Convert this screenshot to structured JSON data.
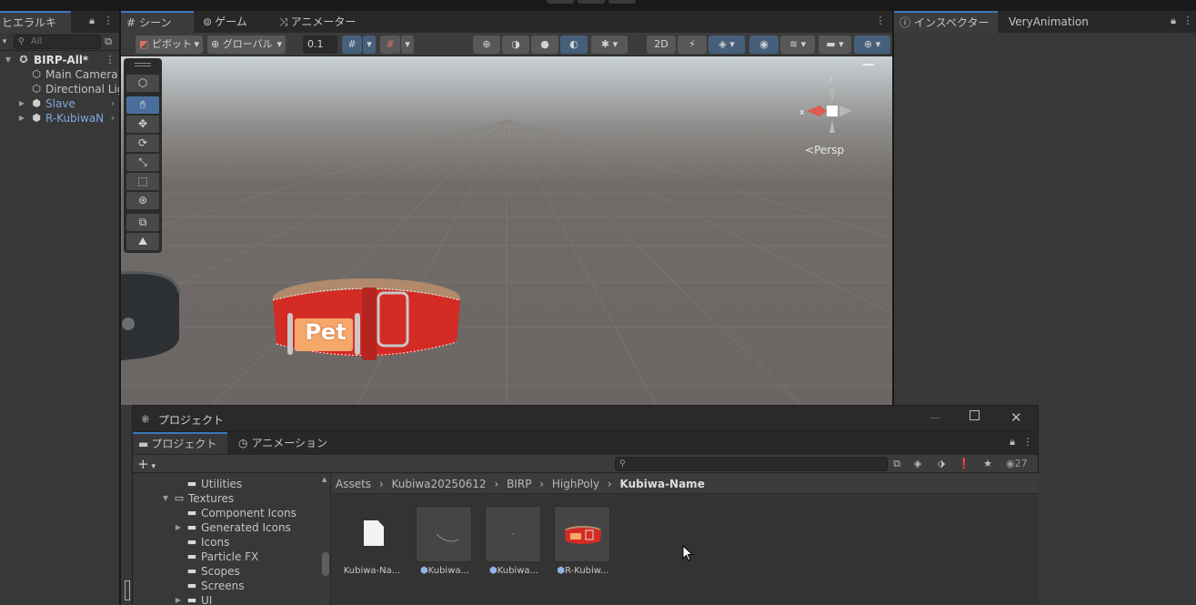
{
  "hierarchy": {
    "tab": "ヒエラルキー",
    "search_placeholder": "All",
    "scene": "BIRP-All*",
    "items": [
      {
        "label": "Main Camera"
      },
      {
        "label": "Directional Light"
      },
      {
        "label": "Slave"
      },
      {
        "label": "R-KubiwaN"
      }
    ]
  },
  "scene_tabs": {
    "scene": "シーン",
    "game": "ゲーム",
    "animator": "アニメーター"
  },
  "scene_toolbar": {
    "pivot": "ピボット",
    "global": "グローバル",
    "snap_value": "0.1"
  },
  "viewport": {
    "persp": "Persp",
    "collar_text": "Pet"
  },
  "inspector": {
    "tab1": "インスペクター",
    "tab2": "VeryAnimation"
  },
  "project": {
    "window_title": "プロジェクト",
    "tab_project": "プロジェクト",
    "tab_animation": "アニメーション",
    "add_label": "+",
    "count": "27",
    "folders": [
      "Utilities",
      "Textures",
      "Component Icons",
      "Generated Icons",
      "Icons",
      "Particle FX",
      "Scopes",
      "Screens",
      "UI"
    ],
    "breadcrumb": [
      "Assets",
      "Kubiwa20250612",
      "BIRP",
      "HighPoly",
      "Kubiwa-Name"
    ],
    "assets": [
      {
        "name": "Kubiwa-Na...",
        "kind": "file-icon"
      },
      {
        "name": "Kubiwa...",
        "kind": "mesh-icon"
      },
      {
        "name": "Kubiwa...",
        "kind": "mesh-icon"
      },
      {
        "name": "R-Kubiw...",
        "kind": "prefab-icon"
      }
    ]
  },
  "colors": {
    "accent": "#3a79bb",
    "collar_red": "#d42b25",
    "prefab_blue": "#7fa7e0"
  }
}
